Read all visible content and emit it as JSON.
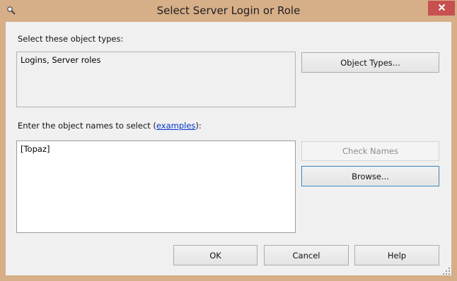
{
  "window": {
    "title": "Select Server Login or Role"
  },
  "object_types": {
    "label": "Select these object types:",
    "value": "Logins, Server roles",
    "button_label": "Object Types..."
  },
  "object_names": {
    "label_prefix": "Enter the object names to select (",
    "label_link": "examples",
    "label_suffix": "):",
    "value": "[Topaz]",
    "check_names_label": "Check Names",
    "browse_label": "Browse..."
  },
  "footer": {
    "ok_label": "OK",
    "cancel_label": "Cancel",
    "help_label": "Help"
  },
  "colors": {
    "title_bar": "#d6ae88",
    "close_button": "#c75050",
    "dialog_bg": "#f0f0f0",
    "link": "#0033cc"
  },
  "icons": {
    "app": "magnifier-icon",
    "close": "close-icon",
    "resize": "resize-grip-icon"
  }
}
